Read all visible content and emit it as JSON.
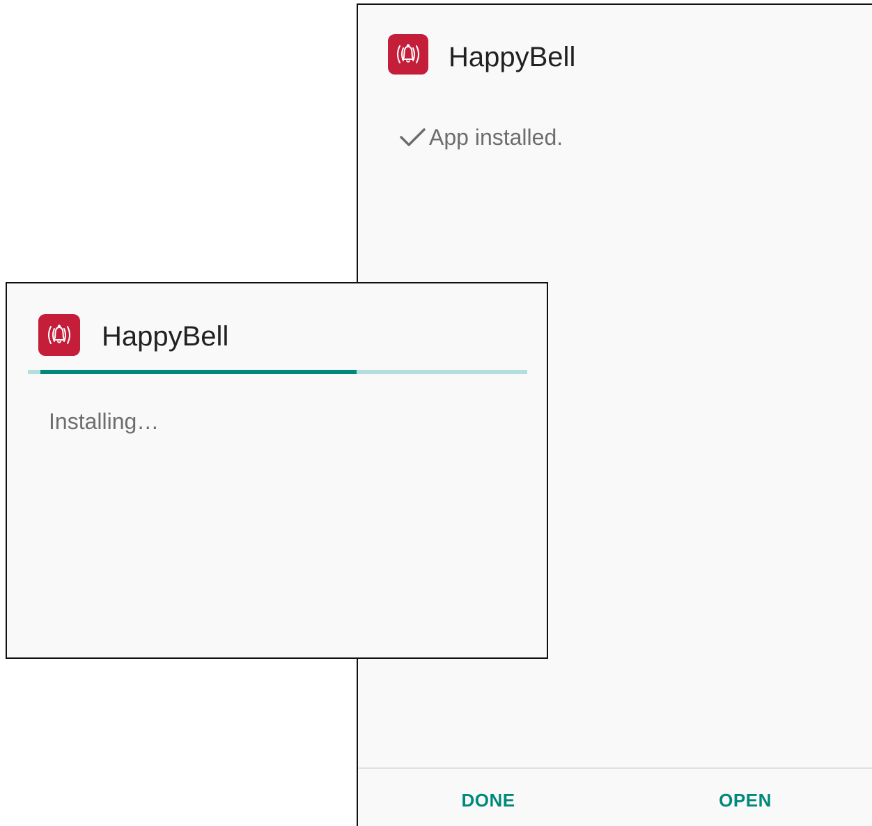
{
  "installed_dialog": {
    "app_name": "HappyBell",
    "app_icon": "bell-ringing-icon",
    "check_icon": "check-icon",
    "status": "App installed.",
    "buttons": {
      "done_label": "DONE",
      "open_label": "OPEN"
    }
  },
  "installing_dialog": {
    "app_name": "HappyBell",
    "app_icon": "bell-ringing-icon",
    "status": "Installing…",
    "progress": 0.65
  },
  "colors": {
    "icon_bg": "#c41e3a",
    "accent": "#00897b",
    "progress_track": "#b2dfdb",
    "title_text": "#212121",
    "status_text": "#6d6d6d",
    "panel_bg": "#f9f9f9"
  }
}
